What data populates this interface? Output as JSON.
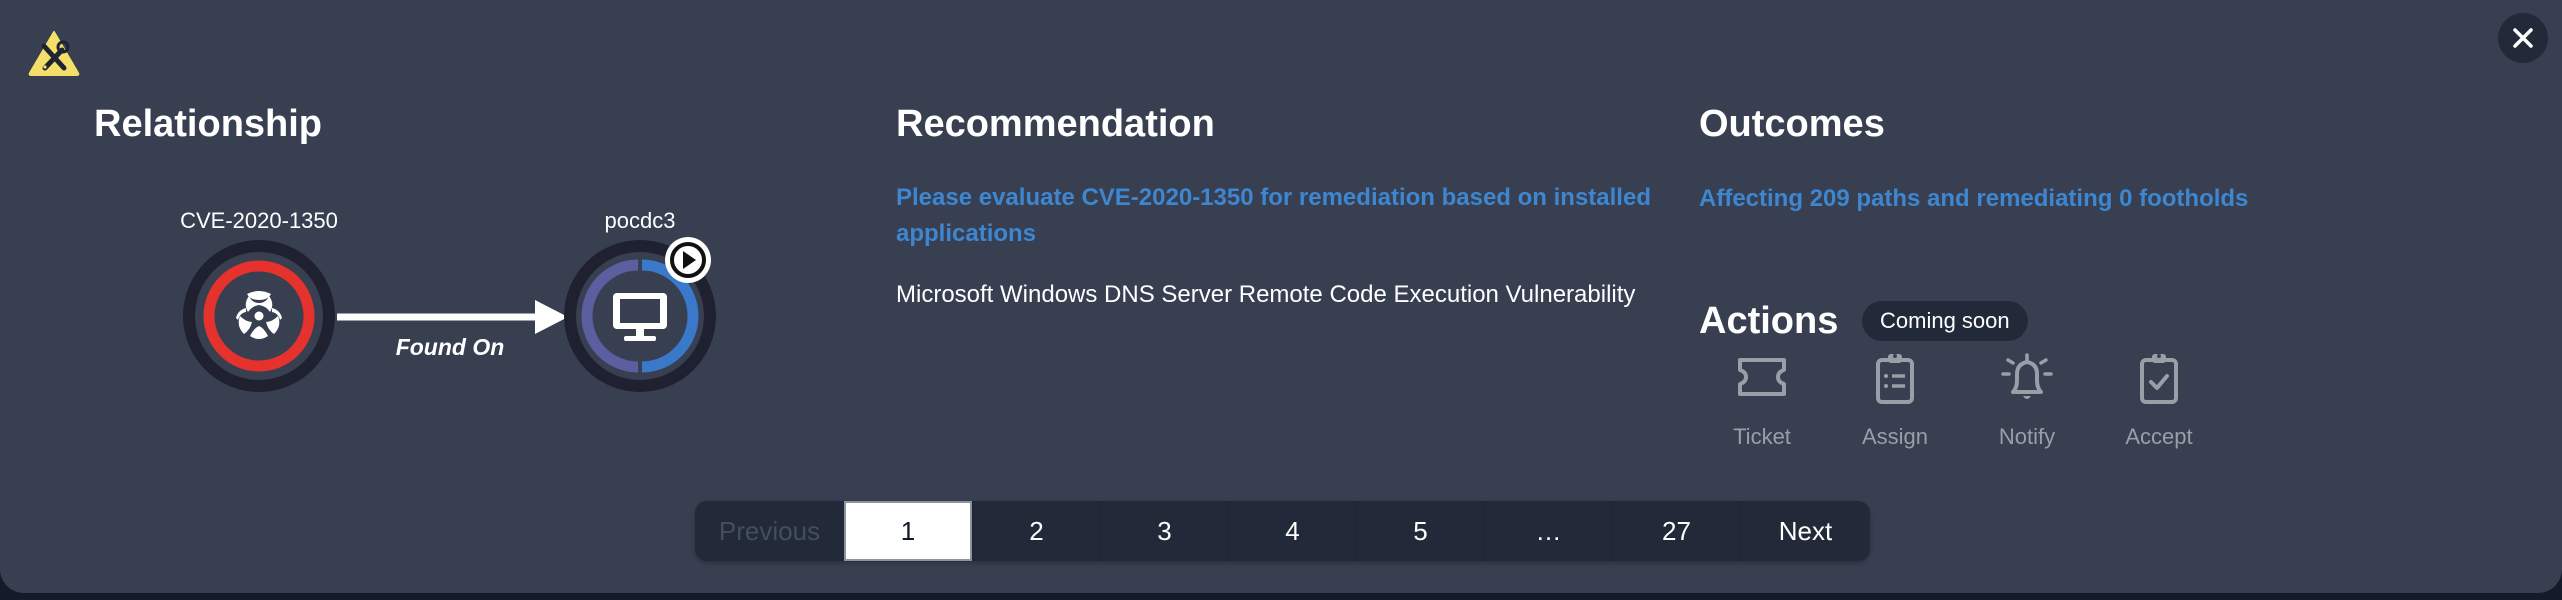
{
  "header": {
    "logo_icon": "tools-warning-icon",
    "close_icon": "close-icon"
  },
  "relationship": {
    "title": "Relationship",
    "source_node": {
      "label": "CVE-2020-1350",
      "icon": "biohazard-icon",
      "ring_color": "#e5322d"
    },
    "target_node": {
      "label": "pocdc3",
      "icon": "monitor-icon",
      "badge_icon": "play-icon",
      "ring_colors": [
        "#5b5fa0",
        "#3a78c9"
      ]
    },
    "edge_label": "Found On"
  },
  "recommendation": {
    "title": "Recommendation",
    "text": "Please evaluate CVE-2020-1350 for remediation based on installed applications",
    "description": "Microsoft Windows DNS Server Remote Code Execution Vulnerability"
  },
  "outcomes": {
    "title": "Outcomes",
    "text": "Affecting 209 paths and remediating 0 footholds"
  },
  "actions": {
    "title": "Actions",
    "badge": "Coming soon",
    "items": [
      {
        "label": "Ticket",
        "icon": "ticket-icon"
      },
      {
        "label": "Assign",
        "icon": "clipboard-list-icon"
      },
      {
        "label": "Notify",
        "icon": "bell-icon"
      },
      {
        "label": "Accept",
        "icon": "clipboard-check-icon"
      }
    ]
  },
  "pagination": {
    "previous": "Previous",
    "pages": [
      "1",
      "2",
      "3",
      "4",
      "5",
      "…",
      "27"
    ],
    "current": "1",
    "next": "Next"
  },
  "colors": {
    "background": "#373f51",
    "accent_blue": "#3e86d0",
    "danger_red": "#e5322d",
    "logo_yellow": "#f5df6b"
  }
}
